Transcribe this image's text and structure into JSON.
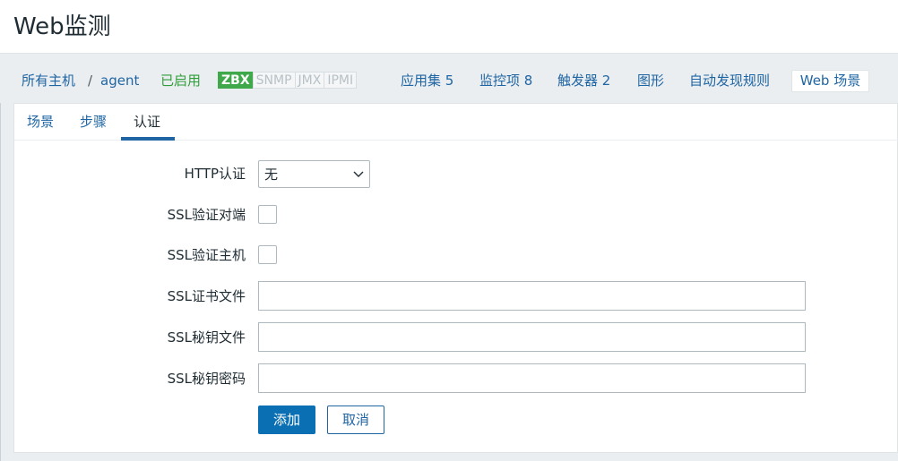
{
  "page": {
    "title": "Web监测"
  },
  "host_nav": {
    "all_hosts": "所有主机",
    "separator": "/",
    "host": "agent",
    "status": "已启用",
    "availability": [
      "ZBX",
      "SNMP",
      "JMX",
      "IPMI"
    ],
    "applications": "应用集 5",
    "items": "监控项 8",
    "triggers": "触发器 2",
    "graphs": "图形",
    "discovery": "自动发现规则",
    "web": "Web 场景"
  },
  "tabs": [
    "场景",
    "步骤",
    "认证"
  ],
  "form": {
    "http_auth_label": "HTTP认证",
    "http_auth_value": "无",
    "ssl_verify_peer_label": "SSL验证对端",
    "ssl_verify_host_label": "SSL验证主机",
    "ssl_cert_file_label": "SSL证书文件",
    "ssl_key_file_label": "SSL秘钥文件",
    "ssl_key_password_label": "SSL秘钥密码",
    "ssl_cert_file_value": "",
    "ssl_key_file_value": "",
    "ssl_key_password_value": ""
  },
  "buttons": {
    "add": "添加",
    "cancel": "取消"
  },
  "colors": {
    "link": "#1f65a3",
    "enabled": "#2f9e3a",
    "zbx": "#3fa84a",
    "primary": "#0a6fb3"
  }
}
